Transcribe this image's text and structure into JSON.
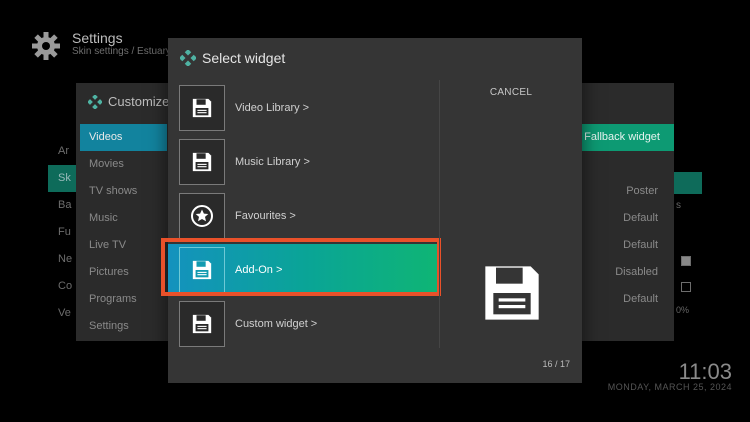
{
  "background": {
    "title": "Settings",
    "subtitle": "Skin settings / Estuary",
    "list_items": [
      "Ar",
      "Sk",
      "Ba",
      "Fu",
      "Ne",
      "Co",
      "Ve"
    ],
    "right_text": "s",
    "clock": "11:03",
    "date": "MONDAY, MARCH 25, 2024",
    "percent": "0%"
  },
  "customize": {
    "title": "Customize",
    "categories": [
      "Videos",
      "Movies",
      "TV shows",
      "Music",
      "Live TV",
      "Pictures",
      "Programs",
      "Settings"
    ],
    "values": [
      "Fallback widget",
      "",
      "Poster",
      "Default",
      "Default",
      "Disabled",
      "Default"
    ]
  },
  "dialog": {
    "title": "Select widget",
    "items": [
      {
        "label": "Video Library  >",
        "icon": "floppy-disk-icon"
      },
      {
        "label": "Music Library  >",
        "icon": "floppy-disk-icon"
      },
      {
        "label": "Favourites  >",
        "icon": "star-icon"
      },
      {
        "label": "Add-On  >",
        "icon": "floppy-disk-icon"
      },
      {
        "label": "Custom widget  >",
        "icon": "floppy-disk-icon"
      }
    ],
    "cancel_label": "CANCEL",
    "page_count": "16 / 17",
    "colors": {
      "focus_start": "#1492be",
      "focus_end": "#0fb574",
      "highlight": "#e9512a"
    }
  }
}
